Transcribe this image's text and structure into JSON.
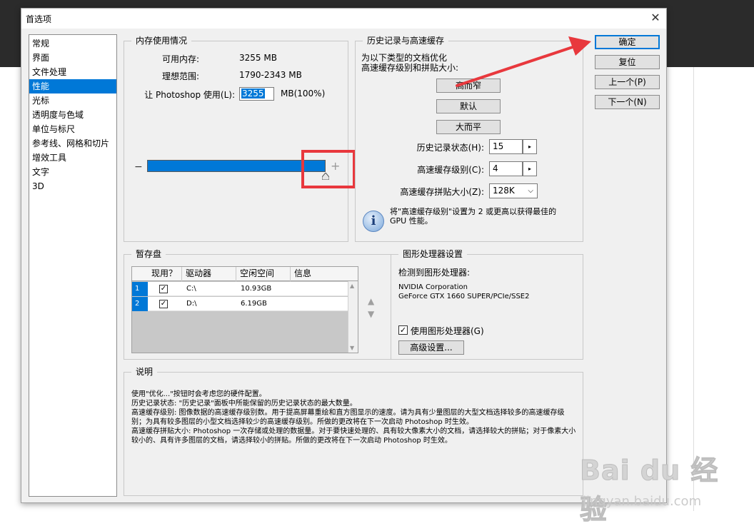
{
  "dialog": {
    "title": "首选项",
    "close_glyph": "✕"
  },
  "nav": {
    "items": [
      {
        "label": "常规",
        "active": false
      },
      {
        "label": "界面",
        "active": false
      },
      {
        "label": "文件处理",
        "active": false
      },
      {
        "label": "性能",
        "active": true
      },
      {
        "label": "光标",
        "active": false
      },
      {
        "label": "透明度与色域",
        "active": false
      },
      {
        "label": "单位与标尺",
        "active": false
      },
      {
        "label": "参考线、网格和切片",
        "active": false
      },
      {
        "label": "增效工具",
        "active": false
      },
      {
        "label": "文字",
        "active": false
      },
      {
        "label": "3D",
        "active": false
      }
    ]
  },
  "memory": {
    "title": "内存使用情况",
    "available_label": "可用内存:",
    "available_value": "3255 MB",
    "ideal_label": "理想范围:",
    "ideal_value": "1790-2343 MB",
    "use_label": "让 Photoshop 使用(L):",
    "use_value": "3255",
    "use_unit": "MB(100%)",
    "slider_minus": "−",
    "slider_plus": "+",
    "slider_fraction": 1.0
  },
  "history": {
    "title": "历史记录与高速缓存",
    "optimize_line1": "为以下类型的文档优化",
    "optimize_line2": "高速缓存级别和拼贴大小:",
    "btn_tall_narrow": "高而窄",
    "btn_default": "默认",
    "btn_big_flat": "大而平",
    "states_label": "历史记录状态(H):",
    "states_value": "15",
    "cache_levels_label": "高速缓存级别(C):",
    "cache_levels_value": "4",
    "tile_size_label": "高速缓存拼贴大小(Z):",
    "tile_size_value": "128K",
    "spin_glyph": "▸",
    "dropdown_glyph": "⌵",
    "info_glyph": "i",
    "info_line1": "将\"高速缓存级别\"设置为 2 或更高以获得最佳的",
    "info_line2": "GPU 性能。"
  },
  "scratch": {
    "title": "暂存盘",
    "columns": [
      "现用？",
      "驱动器",
      "空闲空间",
      "信息"
    ],
    "rows": [
      {
        "num": "1",
        "checked": "✓",
        "drive": "C:\\",
        "free": "10.93GB"
      },
      {
        "num": "2",
        "checked": "✓",
        "drive": "D:\\",
        "free": "6.19GB"
      }
    ],
    "up_glyph": "▲",
    "down_glyph": "▼"
  },
  "gpu": {
    "title": "图形处理器设置",
    "detected_label": "检测到图形处理器:",
    "vendor": "NVIDIA Corporation",
    "model": "GeForce GTX 1660 SUPER/PCIe/SSE2",
    "use_gpu_label": "使用图形处理器(G)",
    "use_gpu_check": "✓",
    "advanced_label": "高级设置..."
  },
  "description": {
    "title": "说明",
    "lines": [
      "使用\"优化...\"按钮时会考虑您的硬件配置。",
      "历史记录状态: \"历史记录\"面板中所能保留的历史记录状态的最大数量。",
      "高速缓存级别: 图像数据的高速缓存级别数。用于提高屏幕重绘和直方图显示的速度。请为具有少量图层的大型文档选择较多的高速缓存级别；为具有较多图层的小型文档选择较少的高速缓存级别。所做的更改将在下一次启动 Photoshop 时生效。",
      "高速缓存拼贴大小: Photoshop 一次存储或处理的数据量。对于要快速处理的、具有较大像素大小的文档，请选择较大的拼贴；对于像素大小较小的、具有许多图层的文档，请选择较小的拼贴。所做的更改将在下一次启动 Photoshop 时生效。"
    ]
  },
  "buttons": {
    "ok": "确定",
    "reset": "复位",
    "prev": "上一个(P)",
    "next": "下一个(N)"
  },
  "annotation": {
    "color": "#e8383d"
  },
  "watermark": {
    "logo": "Bai du 经验",
    "url": "jingyan.baidu.com"
  },
  "colors": {
    "accent": "#0078d7",
    "dialog_bg": "#f0f0f0",
    "dark_bg": "#2b2b2b"
  }
}
